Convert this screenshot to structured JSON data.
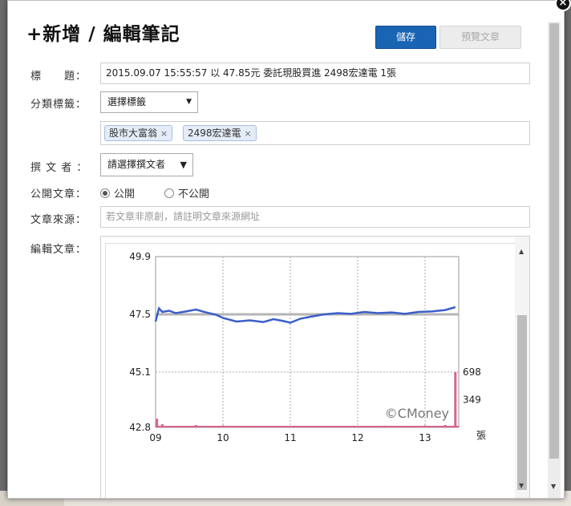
{
  "dialog": {
    "title": "+新增 / 編輯筆記",
    "close_glyph": "×",
    "save_label": "儲存",
    "preview_label": "預覽文章"
  },
  "form": {
    "title_label": "標　　題：",
    "title_value": "2015.09.07 15:55:57 以 47.85元  委託現股買進 2498宏達電 1張",
    "category_label": "分類標籤：",
    "category_select": "選擇標籤",
    "tags": [
      "股市大富翁",
      "2498宏達電"
    ],
    "tag_remove_glyph": "×",
    "author_label": "撰 文 者 ：",
    "author_select": "請選擇撰文者",
    "public_label": "公開文章：",
    "public_options": [
      "公開",
      "不公開"
    ],
    "public_selected": "公開",
    "source_label": "文章來源：",
    "source_placeholder": "若文章非原創，請註明文章來源網址",
    "editor_label": "編輯文章："
  },
  "icons": {
    "close": "close-icon",
    "dropdown": "chevron-down-icon",
    "remove": "remove-tag-icon",
    "scroll_up": "scroll-up-icon",
    "scroll_down": "scroll-down-icon"
  },
  "colors": {
    "save_button": "#1a64b4",
    "price_line": "#3a5fc8",
    "reference_line": "#b5b5b5",
    "volume_bars": "#d9648a"
  },
  "chart_data": {
    "type": "line",
    "y_ticks": [
      "49.9",
      "47.5",
      "45.1",
      "42.8"
    ],
    "x_ticks": [
      "09",
      "10",
      "11",
      "12",
      "13"
    ],
    "ylim": [
      42.8,
      49.9
    ],
    "volume_ticks": [
      "698",
      "349"
    ],
    "volume_unit": "張",
    "watermark": "©CMoney",
    "reference_price": 47.5,
    "series": [
      {
        "x": [
          9.0,
          9.05,
          9.1,
          9.2,
          9.3,
          9.45,
          9.6,
          9.75,
          9.9,
          10.0,
          10.2,
          10.4,
          10.6,
          10.75,
          10.9,
          11.0,
          11.15,
          11.3,
          11.5,
          11.7,
          11.9,
          12.1,
          12.3,
          12.5,
          12.7,
          12.9,
          13.1,
          13.3,
          13.45
        ],
        "y": [
          47.2,
          47.75,
          47.6,
          47.65,
          47.55,
          47.62,
          47.7,
          47.58,
          47.48,
          47.35,
          47.2,
          47.25,
          47.18,
          47.3,
          47.22,
          47.15,
          47.32,
          47.4,
          47.5,
          47.55,
          47.52,
          47.6,
          47.55,
          47.58,
          47.52,
          47.6,
          47.62,
          47.68,
          47.8
        ]
      }
    ],
    "volume": {
      "x": [
        9.02,
        9.1,
        9.3,
        9.6,
        9.8,
        10.0,
        10.3,
        10.6,
        10.9,
        11.2,
        11.5,
        11.8,
        12.1,
        12.4,
        12.7,
        13.0,
        13.3,
        13.45
      ],
      "v": [
        110,
        40,
        20,
        30,
        15,
        25,
        15,
        20,
        10,
        18,
        12,
        20,
        15,
        22,
        18,
        25,
        30,
        698
      ]
    }
  }
}
